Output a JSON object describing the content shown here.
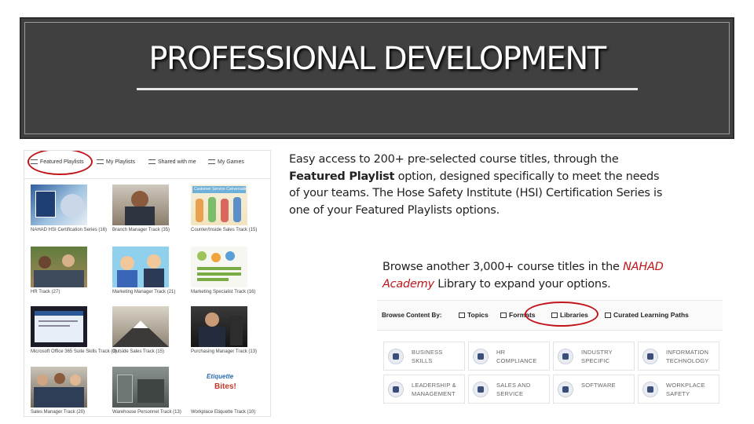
{
  "slide": {
    "title": "PROFESSIONAL DEVELOPMENT"
  },
  "text": {
    "para1_a": "Easy access to 200+ pre-selected course titles, through the ",
    "para1_bold": "Featured Playlist",
    "para1_b": " option, designed specifically to meet the needs of your teams. The Hose Safety Institute (HSI) Certification Series is one of your Featured Playlists options.",
    "para2_a": "Browse another 3,000+ course titles in the ",
    "para2_brand": "NAHAD Academy",
    "para2_b": " Library to expand your options."
  },
  "playlists_screenshot": {
    "tabs": [
      "Featured Playlists",
      "My Playlists",
      "Shared with me",
      "My Games"
    ],
    "tiles": [
      {
        "caption": "NAHAD HSI Certification Series (16)",
        "thumb": "hsi-certification-thumbnail"
      },
      {
        "caption": "Branch Manager Track (35)",
        "thumb": "branch-manager-thumbnail"
      },
      {
        "caption": "Counter/Inside Sales Track (15)",
        "thumb": "inside-sales-thumbnail"
      },
      {
        "caption": "HR Track (27)",
        "thumb": "hr-track-thumbnail"
      },
      {
        "caption": "Marketing Manager Track (21)",
        "thumb": "marketing-manager-thumbnail"
      },
      {
        "caption": "Marketing Specialist Track (16)",
        "thumb": "marketing-specialist-thumbnail"
      },
      {
        "caption": "Microsoft Office 365 Suite Skills Track (3)",
        "thumb": "office-365-thumbnail"
      },
      {
        "caption": "Outside Sales Track (15)",
        "thumb": "outside-sales-thumbnail"
      },
      {
        "caption": "Purchasing Manager Track (13)",
        "thumb": "purchasing-manager-thumbnail"
      },
      {
        "caption": "Sales Manager Track (20)",
        "thumb": "sales-manager-thumbnail"
      },
      {
        "caption": "Warehouse Personnel Track (13)",
        "thumb": "warehouse-personnel-thumbnail"
      },
      {
        "caption": "Workplace Etiquette Track (10)",
        "thumb": "workplace-etiquette-thumbnail"
      }
    ],
    "thumb_texts": {
      "inside_sales_banner": "Customer Service Conversations",
      "etiquette_logo_1": "Etiquette",
      "etiquette_logo_2": "Bites!"
    }
  },
  "library_screenshot": {
    "browse_label": "Browse Content By:",
    "tabs": [
      "Topics",
      "Formats",
      "Libraries",
      "Curated Learning Paths"
    ],
    "categories": [
      {
        "line1": "BUSINESS",
        "line2": "SKILLS",
        "icon": "business-skills-icon"
      },
      {
        "line1": "HR",
        "line2": "COMPLIANCE",
        "icon": "hr-compliance-icon"
      },
      {
        "line1": "INDUSTRY",
        "line2": "SPECIFIC",
        "icon": "industry-specific-icon"
      },
      {
        "line1": "INFORMATION",
        "line2": "TECHNOLOGY",
        "icon": "information-technology-icon"
      },
      {
        "line1": "LEADERSHIP &",
        "line2": "MANAGEMENT",
        "icon": "leadership-management-icon"
      },
      {
        "line1": "SALES AND",
        "line2": "SERVICE",
        "icon": "sales-service-icon"
      },
      {
        "line1": "SOFTWARE",
        "line2": "",
        "icon": "software-icon"
      },
      {
        "line1": "WORKPLACE",
        "line2": "SAFETY",
        "icon": "workplace-safety-icon"
      }
    ]
  },
  "colors": {
    "header_bg": "#404040",
    "highlight_oval": "#c0151a",
    "brand_text": "#c0151a"
  }
}
